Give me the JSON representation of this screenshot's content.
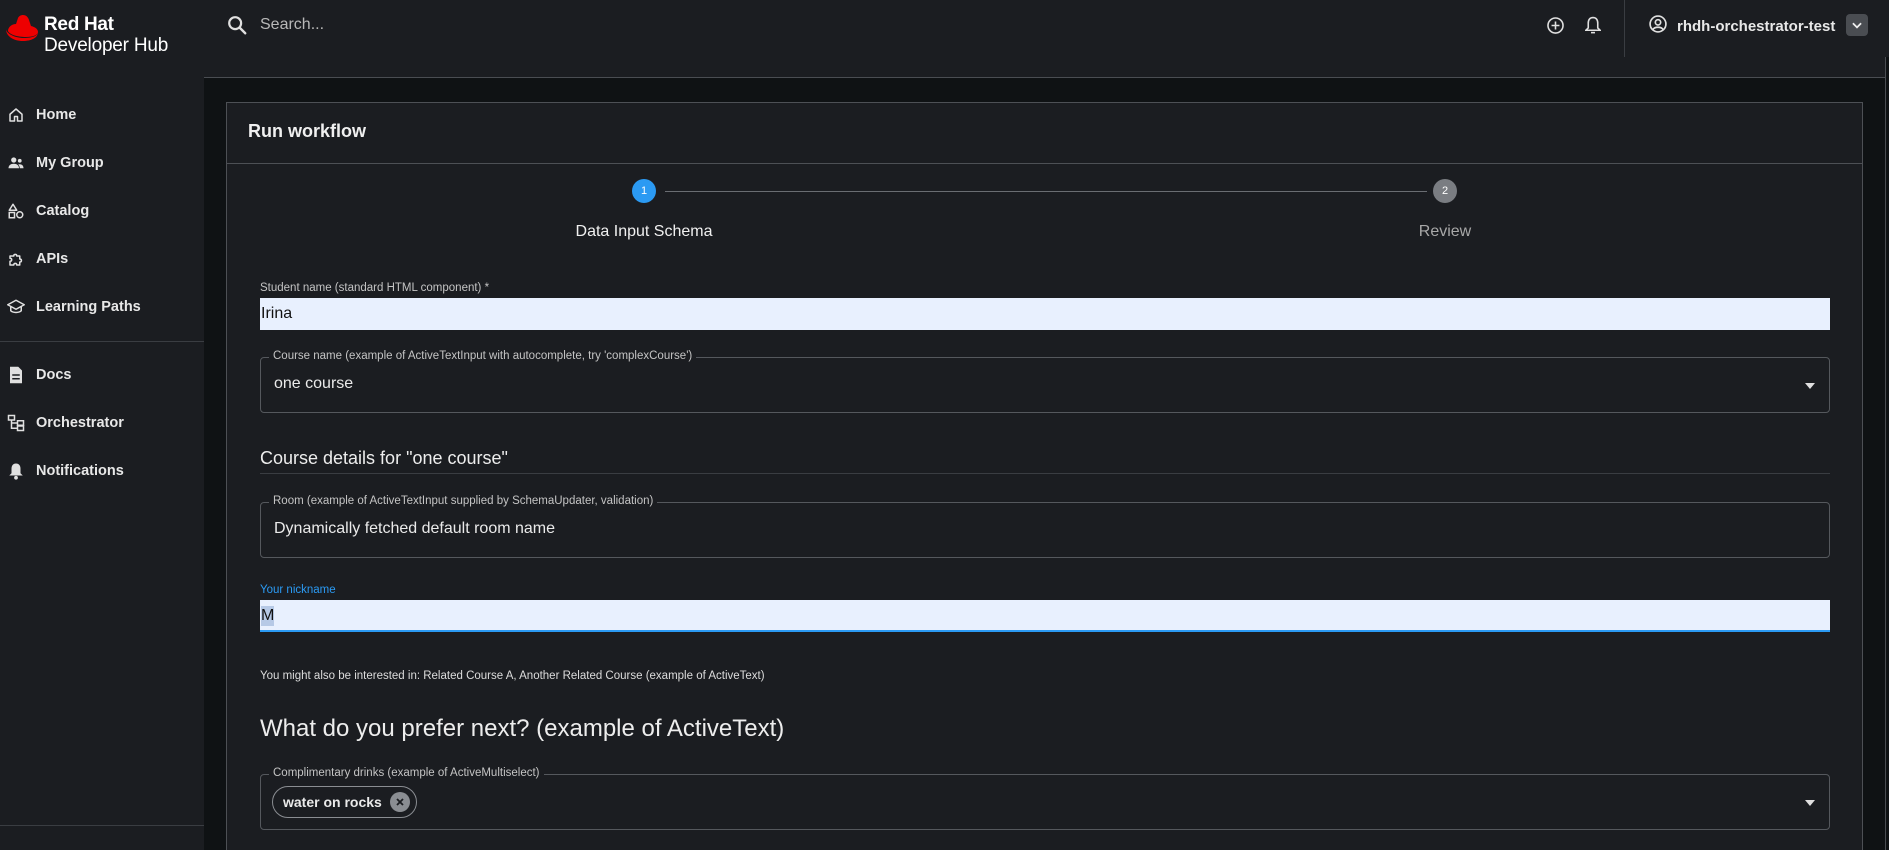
{
  "brand": {
    "line1": "Red Hat",
    "line2": "Developer Hub"
  },
  "sidebar": {
    "items": [
      {
        "label": "Home",
        "icon": "home-icon"
      },
      {
        "label": "My Group",
        "icon": "group-icon"
      },
      {
        "label": "Catalog",
        "icon": "catalog-icon"
      },
      {
        "label": "APIs",
        "icon": "puzzle-icon"
      },
      {
        "label": "Learning Paths",
        "icon": "school-icon"
      },
      {
        "label": "Docs",
        "icon": "document-icon"
      },
      {
        "label": "Orchestrator",
        "icon": "workflow-icon"
      },
      {
        "label": "Notifications",
        "icon": "bell-icon"
      }
    ]
  },
  "header": {
    "search_placeholder": "Search...",
    "user_name": "rhdh-orchestrator-test"
  },
  "card": {
    "title": "Run workflow",
    "steps": [
      {
        "number": "1",
        "label": "Data Input Schema",
        "active": true
      },
      {
        "number": "2",
        "label": "Review",
        "active": false
      }
    ]
  },
  "form": {
    "student_name": {
      "label": "Student name (standard HTML component) *",
      "value": "Irina"
    },
    "course_name": {
      "label": "Course name (example of ActiveTextInput with autocomplete, try 'complexCourse')",
      "value": "one course"
    },
    "course_details_title": "Course details for \"one course\"",
    "room": {
      "label": "Room (example of ActiveTextInput supplied by SchemaUpdater, validation)",
      "value": "Dynamically fetched default room name"
    },
    "nickname": {
      "label": "Your nickname",
      "value": "M"
    },
    "related_text": "You might also be interested in: Related Course A, Another Related Course (example of ActiveText)",
    "prefer_title": "What do you prefer next? (example of ActiveText)",
    "drinks": {
      "label": "Complimentary drinks (example of ActiveMultiselect)",
      "chips": [
        "water on rocks"
      ]
    }
  },
  "colors": {
    "accent": "#2b9af3",
    "brand_red": "#ee0000",
    "input_fill": "#e8f0fe"
  }
}
